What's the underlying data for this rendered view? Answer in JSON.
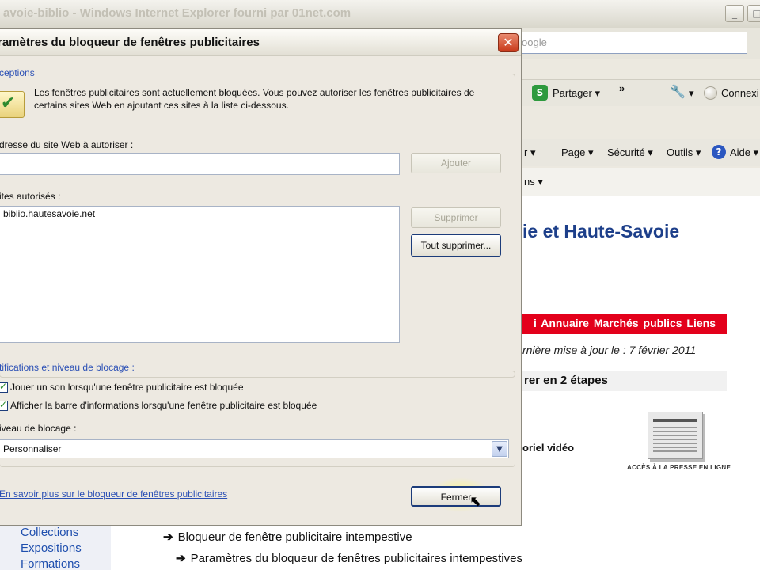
{
  "browser": {
    "title": "avoie-biblio - Windows Internet Explorer fourni par 01net.com",
    "search_placeholder": "oogle",
    "toolbar": {
      "partager": "Partager ▾",
      "chevrons": "»",
      "wrench": "▾",
      "connexion": "Connexi"
    },
    "command_bar": {
      "arrow": "r ▾",
      "page": "Page ▾",
      "securite": "Sécurité ▾",
      "outils": "Outils ▾",
      "aide": "Aide ▾"
    },
    "tab_fragment": "ns ▾"
  },
  "webpage": {
    "site_title": "ie et Haute-Savoie",
    "nav_items": "i  Annuaire  Marchés publics  Liens",
    "update_text": "rnière mise à jour le : 7 février 2011",
    "steps_heading": "rer en 2 étapes",
    "video_label": "oriel vidéo",
    "presse_label": "ACCÈS À LA PRESSE EN LIGNE",
    "side_links": [
      "Collections",
      "Expositions",
      "Formations"
    ],
    "help_lines": [
      "Bloqueur de fenêtre publicitaire intempestive",
      "Paramètres du bloqueur de fenêtres publicitaires intempestives"
    ]
  },
  "dialog": {
    "title": "ramètres du bloqueur de fenêtres publicitaires",
    "close_label": "✕",
    "exceptions": {
      "label": "ceptions",
      "info": "Les fenêtres publicitaires sont actuellement bloquées.  Vous pouvez autoriser les fenêtres publicitaires de certains sites Web en ajoutant ces sites à la liste ci-dessous.",
      "address_label": "dresse du site Web à autoriser :",
      "address_value": "",
      "add_button": "Ajouter",
      "sites_label": "ites autorisés :",
      "sites": [
        "biblio.hautesavoie.net"
      ],
      "remove_button": "Supprimer",
      "remove_all_button": "Tout supprimer..."
    },
    "notifications": {
      "label": "tifications et niveau de blocage :",
      "play_sound": "Jouer un son lorsqu'une fenêtre publicitaire est bloquée",
      "show_info_bar": "Afficher la barre d'informations lorsqu'une fenêtre publicitaire est bloquée",
      "level_label": "iveau de blocage :",
      "level_value": "Personnaliser",
      "level_arrow": "▼"
    },
    "learn_more_link": "En savoir plus sur le bloqueur de fenêtres publicitaires",
    "close_button": "Fermer"
  }
}
